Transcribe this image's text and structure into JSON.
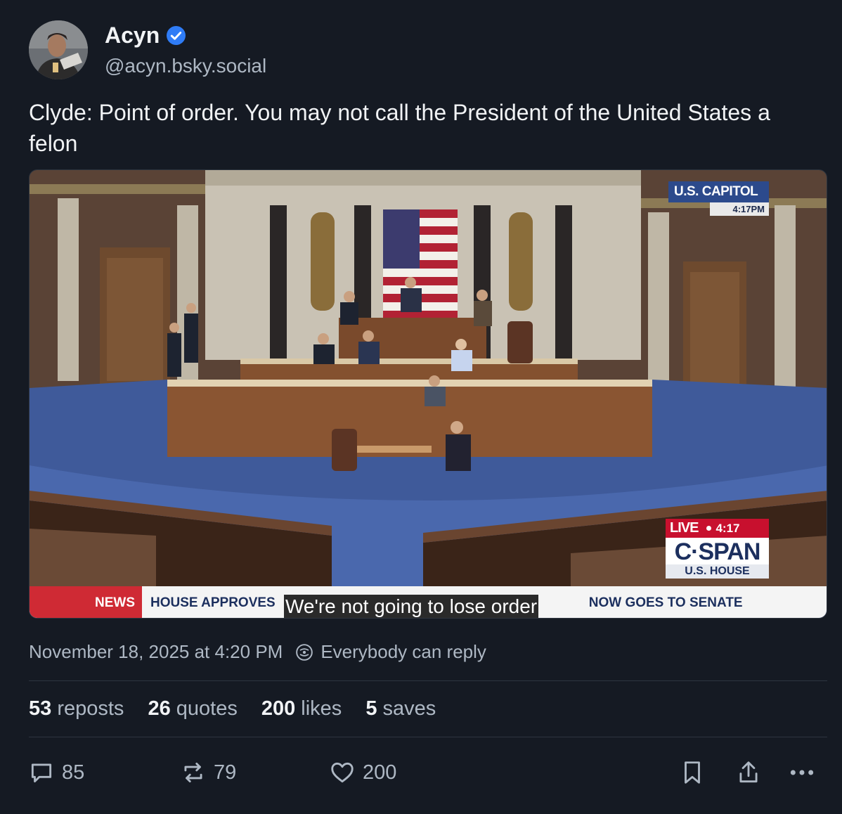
{
  "author": {
    "name": "Acyn",
    "handle": "@acyn.bsky.social"
  },
  "post": {
    "text": "Clyde: Point of order. You may not call the President of the United States a felon"
  },
  "video": {
    "bug_top_label": "U.S. CAPITOL",
    "bug_top_time": "4:17PM",
    "live_label": "LIVE",
    "live_time": "4:17",
    "network": "C·SPAN",
    "network_sub": "U.S. HOUSE",
    "ticker_tag": "NEWS",
    "ticker_left": "HOUSE APPROVES",
    "ticker_right": "NOW GOES TO SENATE",
    "caption": "We're not going to lose order"
  },
  "meta": {
    "date": "November 18, 2025 at 4:20 PM",
    "reply_setting": "Everybody can reply"
  },
  "stats": {
    "reposts_count": "53",
    "reposts_label": "reposts",
    "quotes_count": "26",
    "quotes_label": "quotes",
    "likes_count": "200",
    "likes_label": "likes",
    "saves_count": "5",
    "saves_label": "saves"
  },
  "actions": {
    "replies": "85",
    "reposts": "79",
    "likes": "200"
  },
  "colors": {
    "background": "#151a23",
    "verified": "#2f7cf6",
    "muted_text": "#aeb8c4"
  }
}
